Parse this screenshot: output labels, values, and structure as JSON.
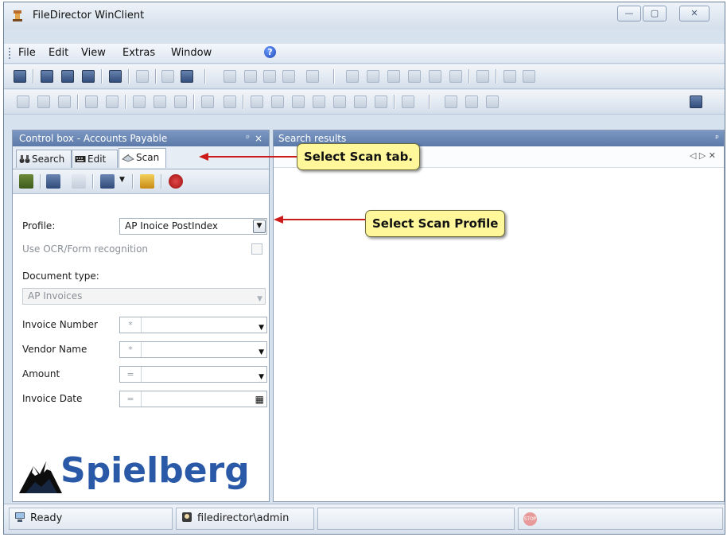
{
  "window": {
    "title": "FileDirector WinClient",
    "controls": [
      "minimize",
      "maximize",
      "close"
    ]
  },
  "menubar": {
    "items": [
      "File",
      "Edit",
      "View",
      "Extras",
      "Window"
    ],
    "help_icon": "help-icon"
  },
  "control_box": {
    "title": "Control box - Accounts Payable",
    "pin": "ᵖ",
    "close": "×",
    "tabs": [
      {
        "label": "Search",
        "icon": "binoculars-icon"
      },
      {
        "label": "Edit",
        "icon": "keyboard-icon"
      },
      {
        "label": "Scan",
        "icon": "scanner-icon",
        "active": true
      }
    ],
    "form": {
      "profile_label": "Profile:",
      "profile_value": "AP Inoice PostIndex",
      "ocr_label": "Use OCR/Form recognition",
      "doctype_label": "Document type:",
      "doctype_value": "AP Invoices",
      "fields": [
        {
          "label": "Invoice Number",
          "op": "*",
          "control": "dropdown"
        },
        {
          "label": "Vendor Name",
          "op": "*",
          "control": "dropdown"
        },
        {
          "label": "Amount",
          "op": "=",
          "control": "dropdown"
        },
        {
          "label": "Invoice Date",
          "op": "=",
          "control": "calendar"
        }
      ]
    },
    "logo_text": "Spielberg"
  },
  "search_results": {
    "title": "Search results",
    "nav": "◁ ▷ ✕"
  },
  "statusbar": {
    "status": "Ready",
    "user": "filedirector\\admin"
  },
  "callouts": {
    "scan_tab": "Select Scan tab.",
    "scan_profile": "Select Scan Profile"
  },
  "colors": {
    "panel_header": "#6a87b6",
    "callout_fill": "#fff79a",
    "arrow": "#cc1a1a",
    "logo": "#2a5aa7"
  }
}
